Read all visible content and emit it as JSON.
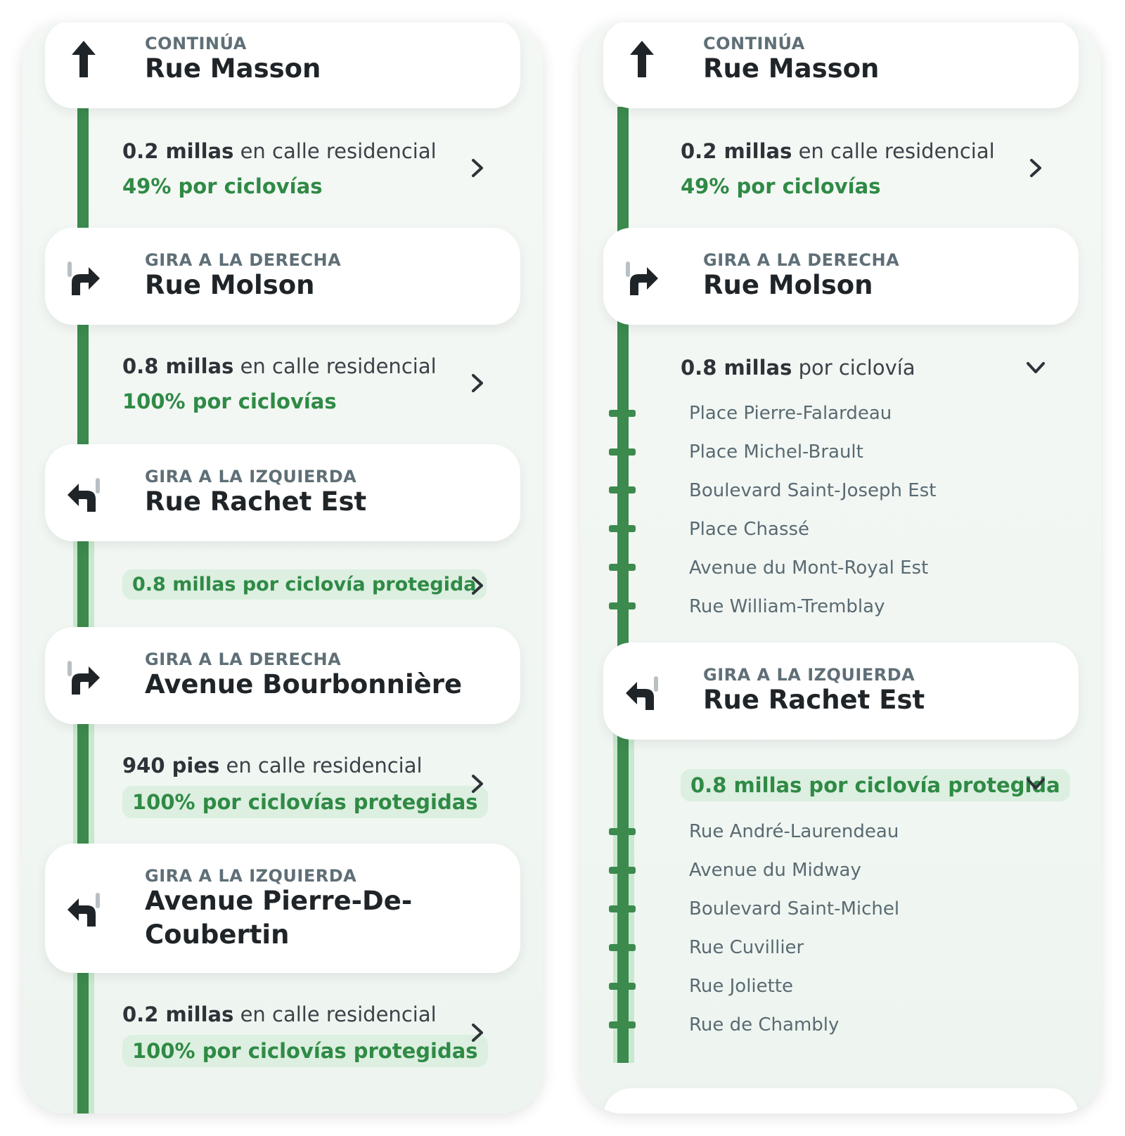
{
  "left": {
    "steps": [
      {
        "kind": "CONTINÚA",
        "street": "Rue Masson",
        "icon": "arrow-up-icon"
      },
      {
        "kind": "GIRA A LA DERECHA",
        "street": "Rue Molson",
        "icon": "turn-right-icon"
      },
      {
        "kind": "GIRA A LA IZQUIERDA",
        "street": "Rue Rachet Est",
        "icon": "turn-left-icon"
      },
      {
        "kind": "GIRA A LA DERECHA",
        "street": "Avenue Bourbonnière",
        "icon": "turn-right-icon"
      },
      {
        "kind": "GIRA A LA IZQUIERDA",
        "street": "Avenue Pierre-De-Coubertin",
        "icon": "turn-left-icon"
      }
    ],
    "segments": [
      {
        "dist": "0.2 millas",
        "type": "en calle residencial",
        "pct": "49% por ciclovías"
      },
      {
        "dist": "0.8 millas",
        "type": "en calle residencial",
        "pct": "100% por ciclovías"
      },
      {
        "pill": "0.8 millas por ciclovía protegida"
      },
      {
        "dist": "940 pies",
        "type": "en calle residencial",
        "pct_pill": "100% por ciclovías protegidas"
      },
      {
        "dist": "0.2 millas",
        "type": "en calle residencial",
        "pct_pill": "100% por ciclovías protegidas"
      }
    ]
  },
  "right": {
    "steps": [
      {
        "kind": "CONTINÚA",
        "street": "Rue Masson",
        "icon": "arrow-up-icon"
      },
      {
        "kind": "GIRA A LA DERECHA",
        "street": "Rue Molson",
        "icon": "turn-right-icon"
      },
      {
        "kind": "GIRA A LA IZQUIERDA",
        "street": "Rue Rachet Est",
        "icon": "turn-left-icon"
      }
    ],
    "segment1": {
      "dist": "0.2 millas",
      "type": "en calle residencial",
      "pct": "49% por ciclovías"
    },
    "segment2": {
      "dist": "0.8 millas",
      "type": "por ciclovía",
      "streets": [
        "Place Pierre-Falardeau",
        "Place Michel-Brault",
        "Boulevard Saint-Joseph Est",
        "Place Chassé",
        "Avenue du Mont-Royal Est",
        "Rue William-Tremblay"
      ]
    },
    "segment3": {
      "pill": "0.8 millas por ciclovía protegida",
      "streets": [
        "Rue André-Laurendeau",
        "Avenue du Midway",
        "Boulevard Saint-Michel",
        "Rue Cuvillier",
        "Rue Joliette",
        "Rue de Chambly"
      ]
    }
  },
  "colors": {
    "accent_green": "#2f8a45",
    "rail_green": "#3c8a4e",
    "pill_bg": "#dcefe0",
    "text_dark": "#1f2428",
    "text_muted": "#5f6f77"
  }
}
